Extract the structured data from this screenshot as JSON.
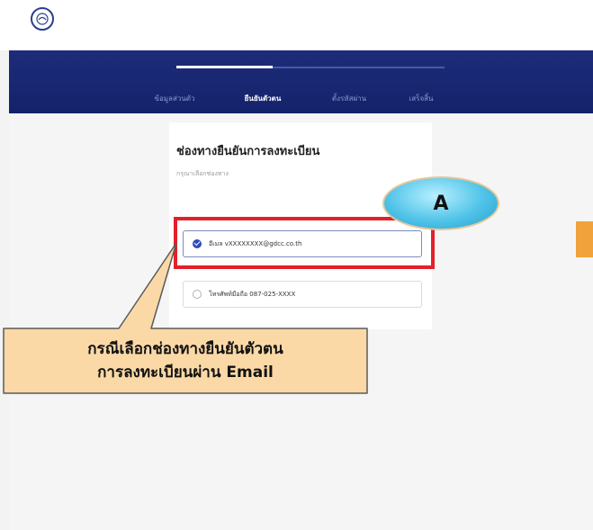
{
  "header": {
    "logo_icon": "thai-ministry-seal-icon"
  },
  "stepper": {
    "steps": [
      {
        "label": "ข้อมูลส่วนตัว",
        "state": "completed"
      },
      {
        "label": "ยืนยันตัวตน",
        "state": "active"
      },
      {
        "label": "ตั้งรหัสผ่าน",
        "state": "pending"
      },
      {
        "label": "เสร็จสิ้น",
        "state": "pending"
      }
    ],
    "progress": 0.36
  },
  "form": {
    "title": "ช่องทางยืนยันการลงทะเบียน",
    "subtitle": "กรุณาเลือกช่องทาง",
    "options": [
      {
        "label": "อีเมล vXXXXXXXX@gdcc.co.th",
        "selected": true
      },
      {
        "label": "โทรศัพท์มือถือ 087-025-XXXX",
        "selected": false
      }
    ]
  },
  "annotation": {
    "badge_label": "A",
    "callout_line1": "กรณีเลือกช่องทางยืนยันตัวตน",
    "callout_line2": "การลงทะเบียนผ่าน Email",
    "highlight_color": "#e3202a",
    "callout_color": "#fbd9a7"
  }
}
